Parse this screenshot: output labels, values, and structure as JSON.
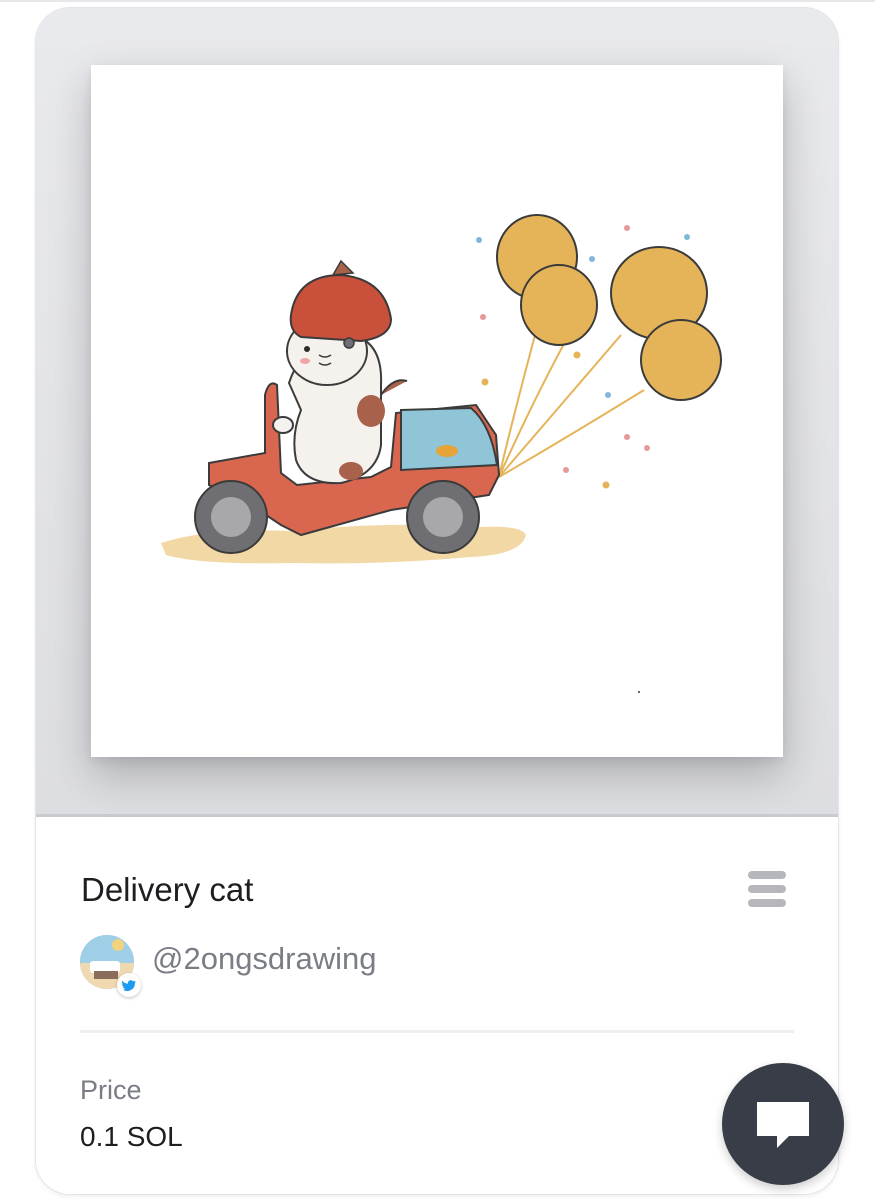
{
  "nft": {
    "title": "Delivery cat",
    "creator_handle": "@2ongsdrawing",
    "price_label": "Price",
    "price_value": "0.1 SOL"
  },
  "icons": {
    "menu": "menu-icon",
    "chat": "chat-icon",
    "verified": "twitter-icon"
  },
  "colors": {
    "balloon": "#e5b458",
    "scooter": "#d9674f",
    "helmet": "#c9503b",
    "fab": "#383d47"
  }
}
